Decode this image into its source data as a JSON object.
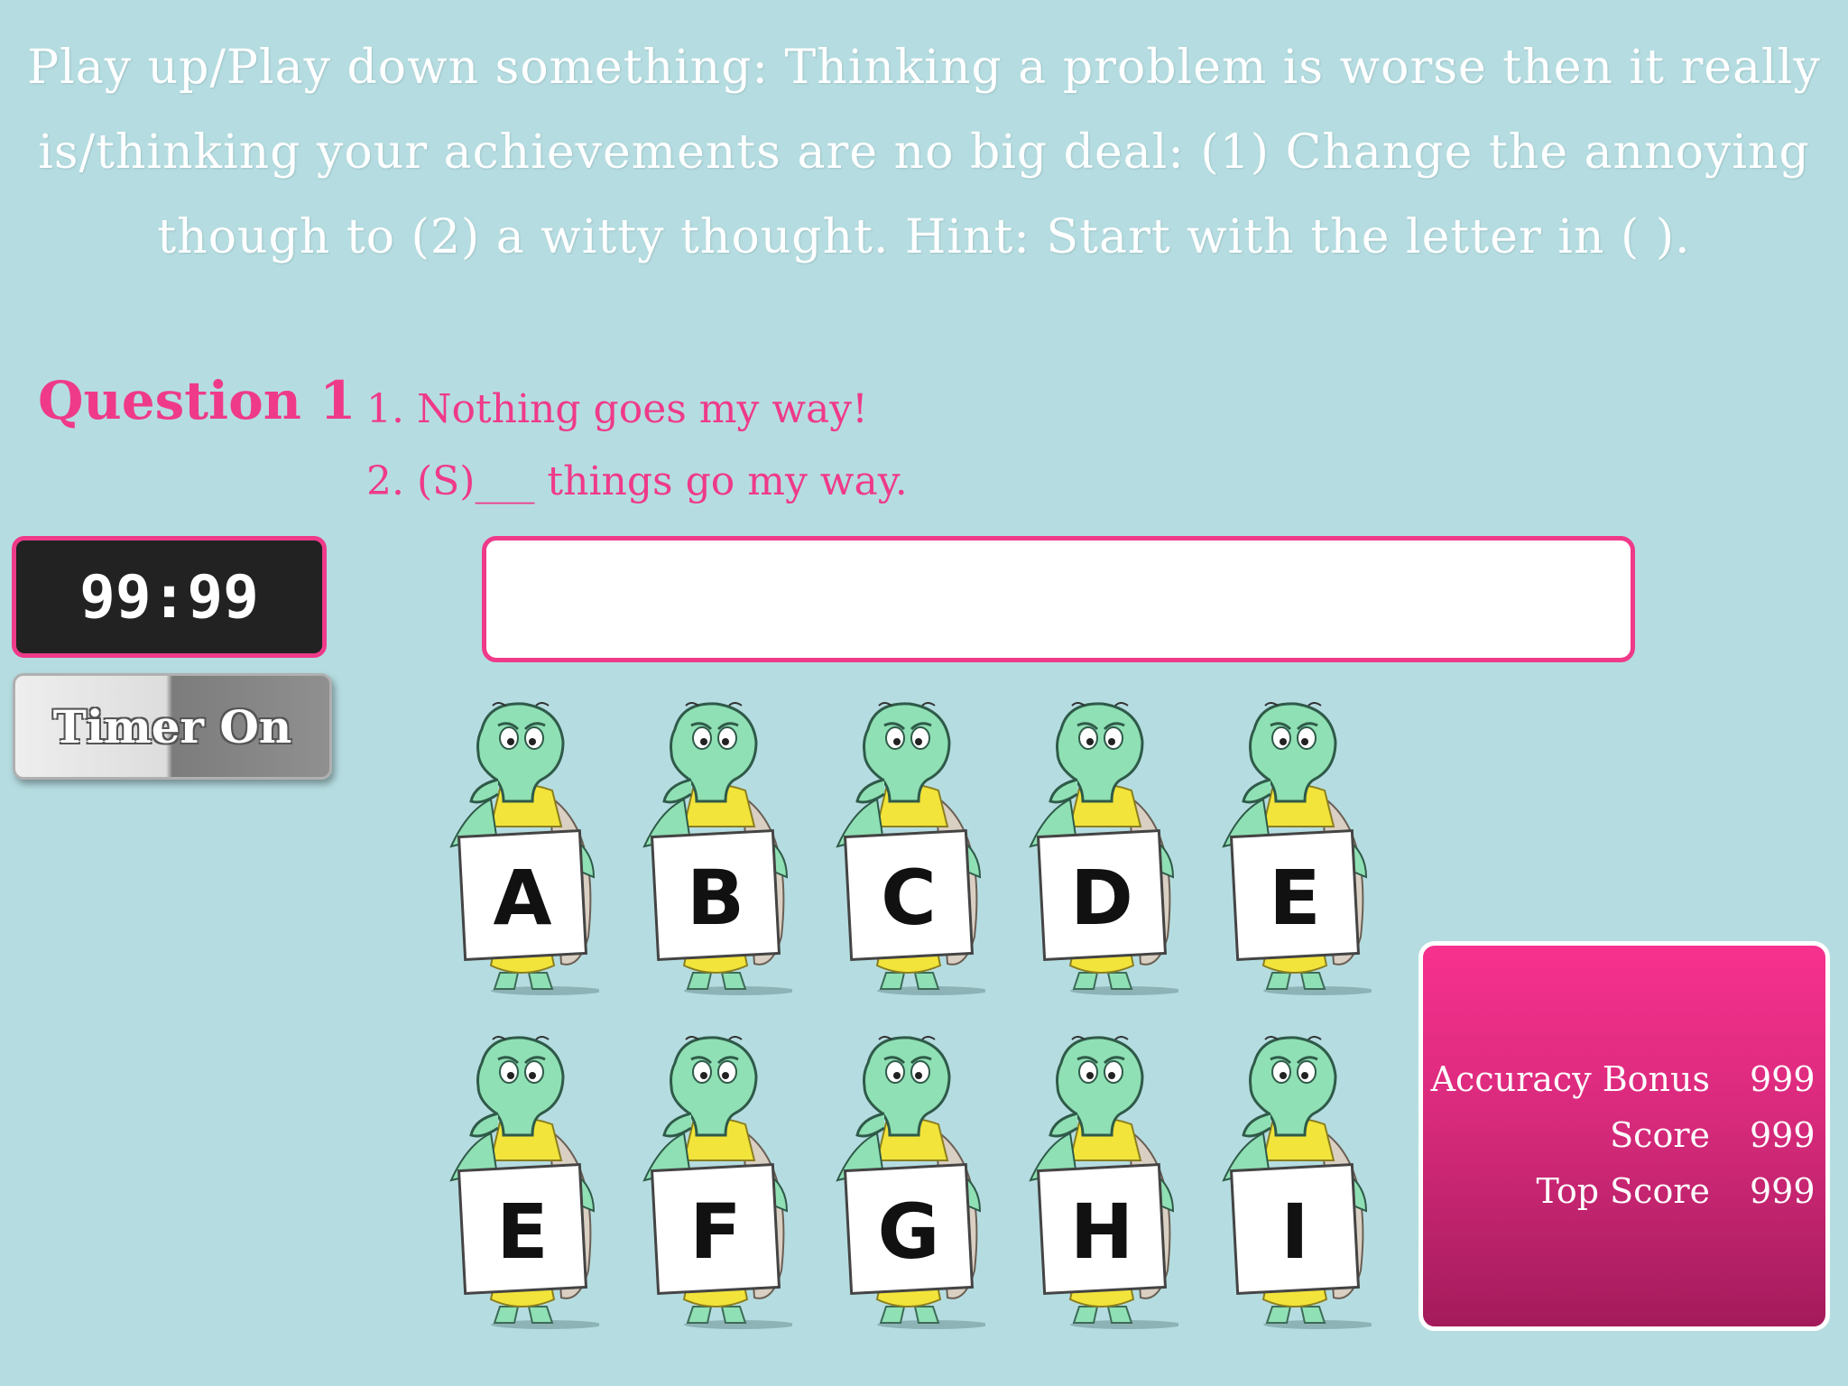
{
  "instructions": "Play up/Play down something:  Thinking a problem is worse then it really is/thinking your achievements are no big deal: (1) Change the annoying though to (2) a witty thought.  Hint:  Start with the letter in ( ).",
  "question": {
    "label": "Question 1",
    "line1": "1. Nothing goes my way!",
    "line2": "2. (S)___ things go my way."
  },
  "timer": {
    "display": "99:99",
    "toggle_label": "Timer On"
  },
  "answer": {
    "value": ""
  },
  "letters": [
    "A",
    "B",
    "C",
    "D",
    "E",
    "E",
    "F",
    "G",
    "H",
    "I"
  ],
  "score": {
    "accuracy_bonus_label": "Accuracy Bonus",
    "accuracy_bonus_value": "999",
    "score_label": "Score",
    "score_value": "999",
    "top_score_label": "Top Score",
    "top_score_value": "999"
  },
  "colors": {
    "background": "#b5dde1",
    "accent_pink": "#ef3a8a",
    "turtle_green": "#8fe0b4",
    "shell_yellow": "#f2e43a"
  },
  "icons": {
    "turtle": "turtle-mascot-icon"
  }
}
